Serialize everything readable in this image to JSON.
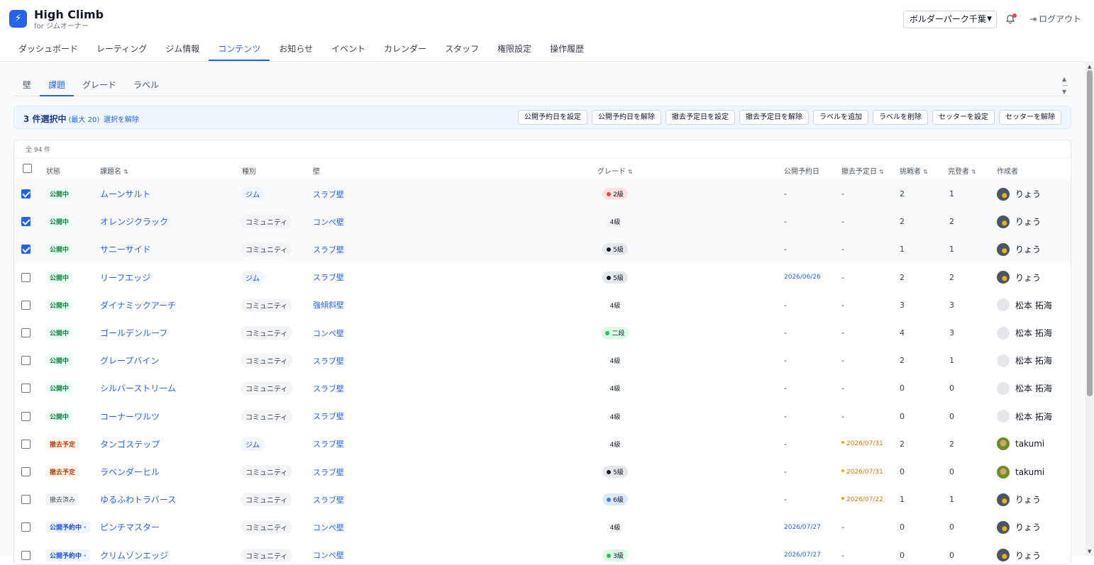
{
  "app": {
    "title": "High Climb",
    "subtitle": "for ジムオーナー",
    "logo_glyph": "⚡"
  },
  "header": {
    "gym_select": "ボルダーパーク千葉",
    "logout": "ログアウト"
  },
  "nav": [
    "ダッシュボード",
    "レーティング",
    "ジム情報",
    "コンテンツ",
    "お知らせ",
    "イベント",
    "カレンダー",
    "スタッフ",
    "権限設定",
    "操作履歴"
  ],
  "nav_active": "コンテンツ",
  "subtabs": [
    "壁",
    "課題",
    "グレード",
    "ラベル"
  ],
  "subtab_active": "課題",
  "selection": {
    "count_label": "3 件選択中",
    "max_label": "(最大 20)",
    "clear_label": "選択を解除",
    "actions": [
      "公開予約日を設定",
      "公開予約日を解除",
      "撤去予定日を設定",
      "撤去予定日を解除",
      "ラベルを追加",
      "ラベルを削除",
      "セッターを設定",
      "セッターを解除"
    ]
  },
  "table": {
    "total": "全 94 件",
    "columns": {
      "status": "状態",
      "name": "課題名",
      "type": "種別",
      "wall": "壁",
      "grade": "グレード",
      "publish": "公開予約日",
      "remove": "撤去予定日",
      "challengers": "挑戦者",
      "completers": "完登者",
      "author": "作成者"
    },
    "rows": [
      {
        "checked": true,
        "status": "公開中",
        "name": "ムーンサルト",
        "type": "ジム",
        "wall": "スラブ壁",
        "grade": "2級",
        "publish": "-",
        "remove": "-",
        "challengers": "2",
        "completers": "1",
        "author": "りょう"
      },
      {
        "checked": true,
        "status": "公開中",
        "name": "オレンジクラック",
        "type": "コミュニティ",
        "wall": "コンペ壁",
        "grade": "4級",
        "publish": "-",
        "remove": "-",
        "challengers": "2",
        "completers": "2",
        "author": "りょう"
      },
      {
        "checked": true,
        "status": "公開中",
        "name": "サニーサイド",
        "type": "コミュニティ",
        "wall": "スラブ壁",
        "grade": "5級",
        "publish": "-",
        "remove": "-",
        "challengers": "1",
        "completers": "1",
        "author": "りょう"
      },
      {
        "checked": false,
        "status": "公開中",
        "name": "リーフエッジ",
        "type": "ジム",
        "wall": "スラブ壁",
        "grade": "5級",
        "publish": "2026/06/26",
        "remove": "-",
        "challengers": "2",
        "completers": "2",
        "author": "りょう"
      },
      {
        "checked": false,
        "status": "公開中",
        "name": "ダイナミックアーチ",
        "type": "コミュニティ",
        "wall": "強傾斜壁",
        "grade": "4級",
        "publish": "-",
        "remove": "-",
        "challengers": "3",
        "completers": "3",
        "author": "松本 拓海"
      },
      {
        "checked": false,
        "status": "公開中",
        "name": "ゴールデンルーフ",
        "type": "コミュニティ",
        "wall": "コンペ壁",
        "grade": "二段",
        "publish": "-",
        "remove": "-",
        "challengers": "4",
        "completers": "3",
        "author": "松本 拓海"
      },
      {
        "checked": false,
        "status": "公開中",
        "name": "グレープバイン",
        "type": "コミュニティ",
        "wall": "スラブ壁",
        "grade": "4級",
        "publish": "-",
        "remove": "-",
        "challengers": "2",
        "completers": "1",
        "author": "松本 拓海"
      },
      {
        "checked": false,
        "status": "公開中",
        "name": "シルバーストリーム",
        "type": "コミュニティ",
        "wall": "スラブ壁",
        "grade": "4級",
        "publish": "-",
        "remove": "-",
        "challengers": "0",
        "completers": "0",
        "author": "松本 拓海"
      },
      {
        "checked": false,
        "status": "公開中",
        "name": "コーナーワルツ",
        "type": "コミュニティ",
        "wall": "スラブ壁",
        "grade": "4級",
        "publish": "-",
        "remove": "-",
        "challengers": "0",
        "completers": "0",
        "author": "松本 拓海"
      },
      {
        "checked": false,
        "status": "撤去予定",
        "name": "タンゴステップ",
        "type": "ジム",
        "wall": "スラブ壁",
        "grade": "4級",
        "publish": "-",
        "remove": "2026/07/31",
        "challengers": "2",
        "completers": "2",
        "author": "takumi"
      },
      {
        "checked": false,
        "status": "撤去予定",
        "name": "ラベンダーヒル",
        "type": "コミュニティ",
        "wall": "スラブ壁",
        "grade": "5級",
        "publish": "-",
        "remove": "2026/07/31",
        "challengers": "0",
        "completers": "0",
        "author": "takumi"
      },
      {
        "checked": false,
        "status": "撤去済み",
        "name": "ゆるふわトラバース",
        "type": "コミュニティ",
        "wall": "スラブ壁",
        "grade": "6級",
        "publish": "-",
        "remove": "2026/07/22",
        "challengers": "1",
        "completers": "1",
        "author": "りょう"
      },
      {
        "checked": false,
        "status": "公開予約中 ·",
        "name": "ピンチマスター",
        "type": "コミュニティ",
        "wall": "コンペ壁",
        "grade": "4級",
        "publish": "2026/07/27",
        "remove": "-",
        "challengers": "0",
        "completers": "0",
        "author": "りょう"
      },
      {
        "checked": false,
        "status": "公開予約中 ·",
        "name": "クリムゾンエッジ",
        "type": "コミュニティ",
        "wall": "コンペ壁",
        "grade": "3級",
        "publish": "2026/07/27",
        "remove": "-",
        "challengers": "0",
        "completers": "0",
        "author": "りょう"
      }
    ]
  },
  "colors": {
    "accent": "#2563eb",
    "grade_2kyu": "#ef4444",
    "grade_5kyu": "#111827",
    "grade_nidan": "#22c55e",
    "grade_6kyu": "#3b82f6",
    "grade_3kyu": "#22c55e"
  }
}
